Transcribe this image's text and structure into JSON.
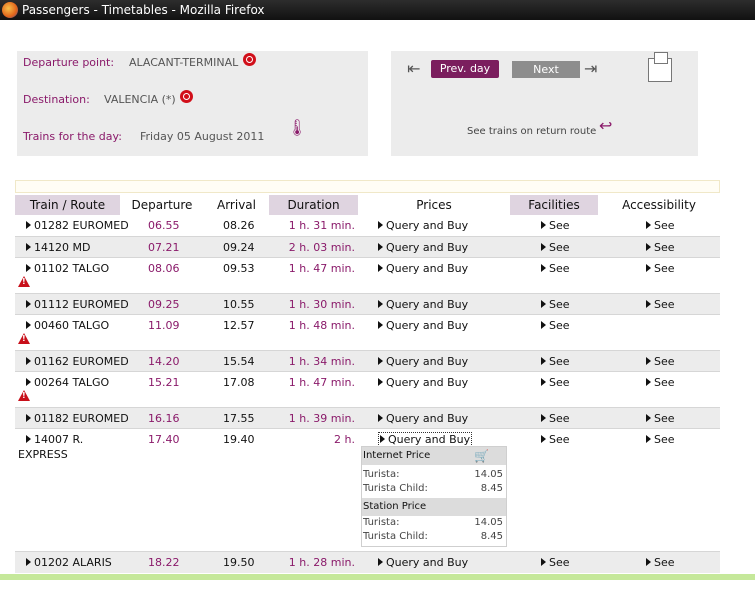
{
  "window": {
    "title": "Passengers - Timetables - Mozilla Firefox"
  },
  "search": {
    "departure_label": "Departure point:",
    "departure_value": "ALACANT-TERMINAL",
    "destination_label": "Destination:",
    "destination_value": "VALENCIA (*)",
    "day_label": "Trains for the day:",
    "day_value": "Friday  05  August  2011"
  },
  "nav": {
    "prev_label": "Prev. day",
    "next_label": "Next",
    "return_label": "See trains on return route"
  },
  "table": {
    "headers": [
      "Train / Route",
      "Departure",
      "Arrival",
      "Duration",
      "Prices",
      "Facilities",
      "Accessibility"
    ],
    "rows": [
      {
        "train": "01282 EUROMED",
        "dep": "06.55",
        "arr": "08.26",
        "dur": "1 h. 31 min.",
        "price": "Query and Buy",
        "fac": "See",
        "acc": "See"
      },
      {
        "train": "14120 MD",
        "dep": "07.21",
        "arr": "09.24",
        "dur": "2 h. 03 min.",
        "price": "Query and Buy",
        "fac": "See",
        "acc": "See"
      },
      {
        "train": "01102 TALGO",
        "dep": "08.06",
        "arr": "09.53",
        "dur": "1 h. 47 min.",
        "price": "Query and Buy",
        "fac": "See",
        "acc": "See"
      },
      {
        "train": "01112 EUROMED",
        "dep": "09.25",
        "arr": "10.55",
        "dur": "1 h. 30 min.",
        "price": "Query and Buy",
        "fac": "See",
        "acc": "See"
      },
      {
        "train": "00460 TALGO",
        "dep": "11.09",
        "arr": "12.57",
        "dur": "1 h. 48 min.",
        "price": "Query and Buy",
        "fac": "See",
        "acc": ""
      },
      {
        "train": "01162 EUROMED",
        "dep": "14.20",
        "arr": "15.54",
        "dur": "1 h. 34 min.",
        "price": "Query and Buy",
        "fac": "See",
        "acc": "See"
      },
      {
        "train": "00264 TALGO",
        "dep": "15.21",
        "arr": "17.08",
        "dur": "1 h. 47 min.",
        "price": "Query and Buy",
        "fac": "See",
        "acc": "See"
      },
      {
        "train": "01182 EUROMED",
        "dep": "16.16",
        "arr": "17.55",
        "dur": "1 h. 39 min.",
        "price": "Query and Buy",
        "fac": "See",
        "acc": "See"
      },
      {
        "train": "14007 R.",
        "train2": "EXPRESS",
        "dep": "17.40",
        "arr": "19.40",
        "dur": "2 h.",
        "price": "Query and Buy",
        "fac": "See",
        "acc": "See"
      },
      {
        "train": "01202 ALARIS",
        "dep": "18.22",
        "arr": "19.50",
        "dur": "1 h. 28 min.",
        "price": "Query and Buy",
        "fac": "See",
        "acc": "See"
      }
    ]
  },
  "price_popup": {
    "internet_title": "Internet Price",
    "internet_rows": [
      {
        "label": "Turista:",
        "value": "14.05"
      },
      {
        "label": "Turista Child:",
        "value": "8.45"
      }
    ],
    "station_title": "Station Price",
    "station_rows": [
      {
        "label": "Turista:",
        "value": "14.05"
      },
      {
        "label": "Turista Child:",
        "value": "8.45"
      }
    ]
  }
}
